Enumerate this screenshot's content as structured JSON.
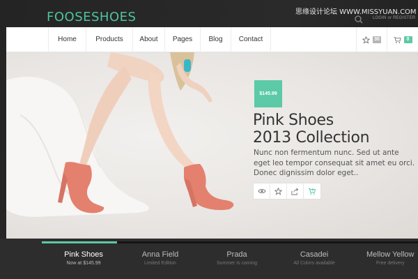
{
  "brand": {
    "logo": "FOOSESHOES",
    "accent": "#5cc9a7"
  },
  "watermark": "思缘设计论坛 WWW.MISSYUAN.COM",
  "top_bar": {
    "search_icon": "search-icon",
    "login_text": "LOGIN or REGISTER"
  },
  "nav": {
    "items": [
      "Home",
      "Products",
      "About",
      "Pages",
      "Blog",
      "Contact"
    ],
    "wishlist": {
      "icon": "star-icon",
      "count": "30"
    },
    "cart": {
      "icon": "cart-icon",
      "count": "0"
    }
  },
  "hero": {
    "price": "$145.99",
    "title_line1": "Pink Shoes",
    "title_line2": "2013 Collection",
    "description": "Nunc non fermentum nunc. Sed ut ante eget leo tempor consequat sit amet eu orci. Donec dignissim dolor eget..",
    "actions": [
      "eye-icon",
      "star-icon",
      "share-icon",
      "add-to-cart-icon"
    ]
  },
  "slider": {
    "progress": 0.2,
    "items": [
      {
        "name": "Pink Shoes",
        "sub": "Now at $145.99",
        "active": true
      },
      {
        "name": "Anna Field",
        "sub": "Limited Edition",
        "active": false
      },
      {
        "name": "Prada",
        "sub": "Summer is coming",
        "active": false
      },
      {
        "name": "Casadei",
        "sub": "All Colors available",
        "active": false
      },
      {
        "name": "Mellow Yellow",
        "sub": "Free delivery",
        "active": false
      }
    ]
  }
}
